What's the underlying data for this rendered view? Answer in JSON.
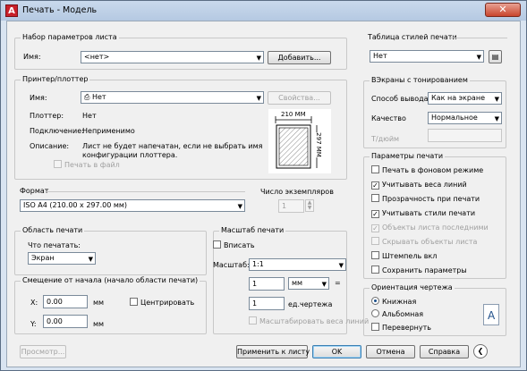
{
  "window": {
    "title": "Печать - Модель",
    "app_icon": "A",
    "close_glyph": "✕"
  },
  "page_setup": {
    "group_label": "Набор параметров листа",
    "name_label": "Имя:",
    "name_value": "<нет>",
    "add_button": "Добавить..."
  },
  "printer": {
    "group_label": "Принтер/плоттер",
    "name_label": "Имя:",
    "name_value": "Нет",
    "properties_button": "Свойства...",
    "plotter_label": "Плоттер:",
    "plotter_value": "Нет",
    "connection_label": "Подключение:",
    "connection_value": "Неприменимо",
    "description_label": "Описание:",
    "description_line1": "Лист не будет напечатан, если не выбрать имя",
    "description_line2": "конфигурации плоттера.",
    "print_to_file": "Печать в файл",
    "preview_width": "210 ММ",
    "preview_height": "297 ММ"
  },
  "paper": {
    "group_label": "Формат",
    "value": "ISO A4 (210.00 x 297.00 мм)"
  },
  "copies": {
    "label": "Число экземпляров",
    "value": "1"
  },
  "plot_area": {
    "group_label": "Область печати",
    "what_label": "Что печатать:",
    "what_value": "Экран"
  },
  "offset": {
    "group_label": "Смещение от начала (начало области печати)",
    "x_label": "X:",
    "x_value": "0.00",
    "x_unit": "мм",
    "y_label": "Y:",
    "y_value": "0.00",
    "y_unit": "мм",
    "center": "Центрировать"
  },
  "scale": {
    "group_label": "Масштаб печати",
    "fit": "Вписать",
    "scale_label": "Масштаб:",
    "scale_value": "1:1",
    "value1": "1",
    "unit1": "мм",
    "equals": "=",
    "value2": "1",
    "unit2": "ед.чертежа",
    "lineweights": "Масштабировать веса линий"
  },
  "style_table": {
    "group_label": "Таблица стилей печати",
    "value": "Нет",
    "edit_icon": "edit-icon"
  },
  "shaded": {
    "group_label": "ВЭкраны с тонированием",
    "output_label": "Способ вывода",
    "output_value": "Как на экране",
    "quality_label": "Качество",
    "quality_value": "Нормальное",
    "dpi_label": "Т/дюйм"
  },
  "plot_options": {
    "group_label": "Параметры печати",
    "items": [
      {
        "label": "Печать в фоновом режиме",
        "checked": "",
        "disabled": false
      },
      {
        "label": "Учитывать веса линий",
        "checked": "✓",
        "disabled": false
      },
      {
        "label": "Прозрачность при печати",
        "checked": "",
        "disabled": false
      },
      {
        "label": "Учитывать стили печати",
        "checked": "✓",
        "disabled": false
      },
      {
        "label": "Объекты листа последними",
        "checked": "✓",
        "disabled": true
      },
      {
        "label": "Скрывать объекты листа",
        "checked": "",
        "disabled": true
      },
      {
        "label": "Штемпель вкл",
        "checked": "",
        "disabled": false
      },
      {
        "label": "Сохранить параметры",
        "checked": "",
        "disabled": false
      }
    ]
  },
  "orientation": {
    "group_label": "Ориентация чертежа",
    "portrait": "Книжная",
    "landscape": "Альбомная",
    "upside_down": "Перевернуть",
    "page_icon_letter": "A"
  },
  "footer": {
    "preview": "Просмотр...",
    "apply": "Применить к листу",
    "ok": "OK",
    "cancel": "Отмена",
    "help": "Справка",
    "collapse_glyph": "❮"
  }
}
